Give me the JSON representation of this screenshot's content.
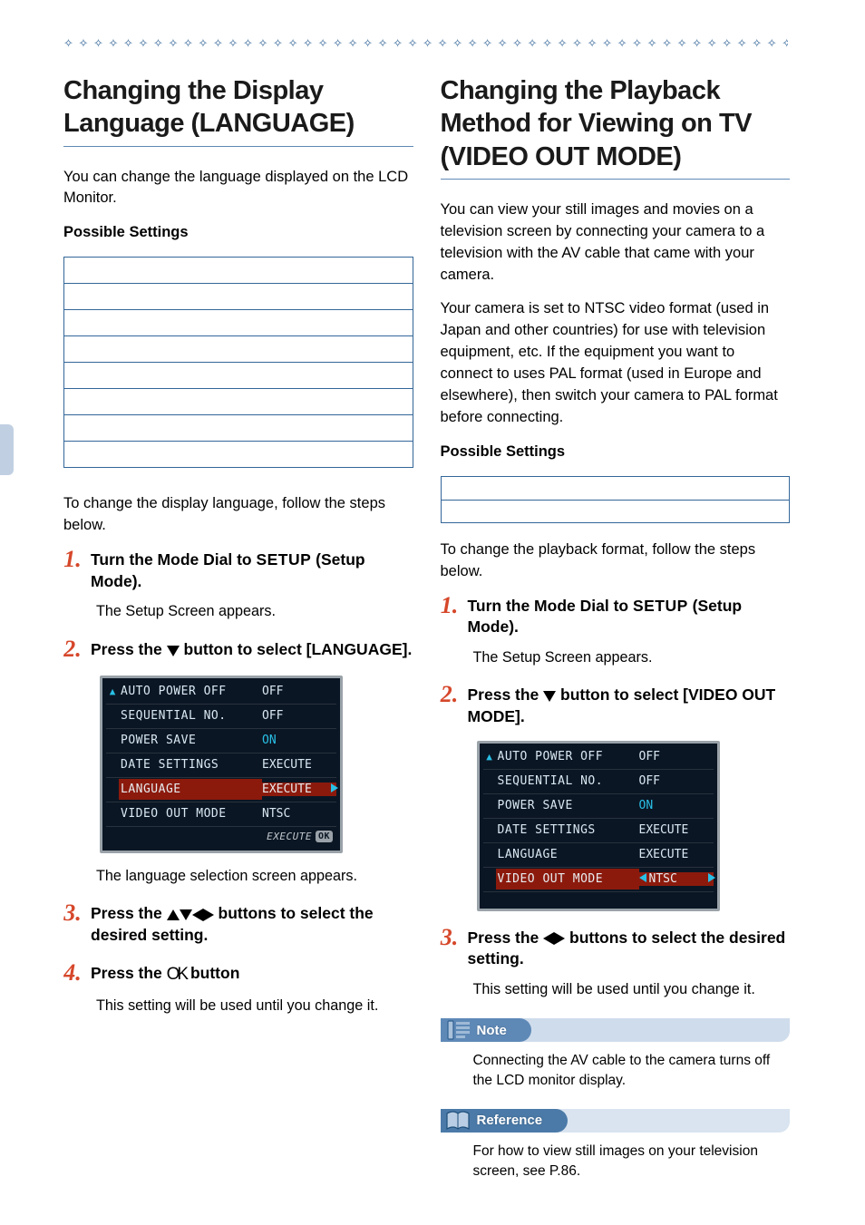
{
  "decoration": {
    "diamonds": "✧ ✧ ✧ ✧ ✧ ✧ ✧ ✧ ✧ ✧ ✧ ✧ ✧ ✧ ✧ ✧ ✧ ✧ ✧ ✧ ✧ ✧ ✧ ✧ ✧ ✧ ✧ ✧ ✧ ✧ ✧ ✧ ✧ ✧ ✧ ✧ ✧ ✧ ✧ ✧ ✧ ✧ ✧ ✧ ✧ ✧ ✧ ✧ ✧ ✧ ✧ ✧ ✧ ✧ ✧ ✧ ✧"
  },
  "left": {
    "heading": "Changing the Display Language (LANGUAGE)",
    "intro": "You can change the language displayed on the LCD Monitor.",
    "possible_label": "Possible Settings",
    "settings_rows": 8,
    "pre_steps": "To change the display language, follow the steps below.",
    "steps": [
      {
        "num": "1",
        "title_pre": "Turn the Mode Dial to ",
        "title_setup": "SETUP",
        "title_post": " (Setup Mode).",
        "body": "The Setup Screen appears."
      },
      {
        "num": "2",
        "title_pre": "Press the ",
        "title_post": " button to select [LANGUAGE].",
        "body": "The language selection screen appears.",
        "lcd": {
          "up_arrow": true,
          "rows": [
            {
              "label": "AUTO POWER OFF",
              "value": "OFF"
            },
            {
              "label": "SEQUENTIAL NO.",
              "value": "OFF"
            },
            {
              "label": "POWER SAVE",
              "value": "ON",
              "cyan": true
            },
            {
              "label": "DATE SETTINGS",
              "value": "EXECUTE"
            },
            {
              "label": "LANGUAGE",
              "value": "EXECUTE",
              "highlight": true,
              "right_tri": true
            },
            {
              "label": "VIDEO OUT MODE",
              "value": "NTSC"
            }
          ],
          "footer_exec": "EXECUTE",
          "footer_ok": "OK"
        }
      },
      {
        "num": "3",
        "title_pre": "Press the ",
        "title_post": " buttons to select the desired setting."
      },
      {
        "num": "4",
        "title_pre": "Press the ",
        "title_post": " button",
        "body": "This setting will be used until you change it."
      }
    ]
  },
  "right": {
    "heading": "Changing the Playback Method for Viewing on TV (VIDEO OUT MODE)",
    "intro1": "You can view your still images and movies on a television screen by connecting your camera to a television with the AV cable that came with your camera.",
    "intro2": "Your camera is set to NTSC video format (used in Japan and other countries) for use with television equipment, etc. If the equipment you want to connect to uses PAL format (used in Europe and elsewhere), then switch your camera to PAL format before connecting.",
    "possible_label": "Possible Settings",
    "settings_rows": 2,
    "pre_steps": "To change the playback format, follow the steps below.",
    "steps": [
      {
        "num": "1",
        "title_pre": "Turn the Mode Dial to ",
        "title_setup": "SETUP",
        "title_post": " (Setup Mode).",
        "body": "The Setup Screen appears."
      },
      {
        "num": "2",
        "title_pre": "Press the ",
        "title_post": " button to select [VIDEO OUT MODE].",
        "lcd": {
          "up_arrow": true,
          "rows": [
            {
              "label": "AUTO POWER OFF",
              "value": "OFF"
            },
            {
              "label": "SEQUENTIAL NO.",
              "value": "OFF"
            },
            {
              "label": "POWER SAVE",
              "value": "ON",
              "cyan": true
            },
            {
              "label": "DATE SETTINGS",
              "value": "EXECUTE"
            },
            {
              "label": "LANGUAGE",
              "value": "EXECUTE"
            },
            {
              "label": "VIDEO OUT MODE",
              "value": "NTSC",
              "highlight": true,
              "left_tri": true,
              "right_tri": true
            }
          ]
        }
      },
      {
        "num": "3",
        "title_pre": "Press the ",
        "title_post": " buttons to select the desired setting.",
        "body": "This setting will be used until you change it."
      }
    ],
    "note": {
      "label": "Note",
      "body": "Connecting the AV cable to the camera turns off the LCD monitor display."
    },
    "reference": {
      "label": "Reference",
      "body": "For how to view still images on your television screen, see P.86."
    }
  }
}
